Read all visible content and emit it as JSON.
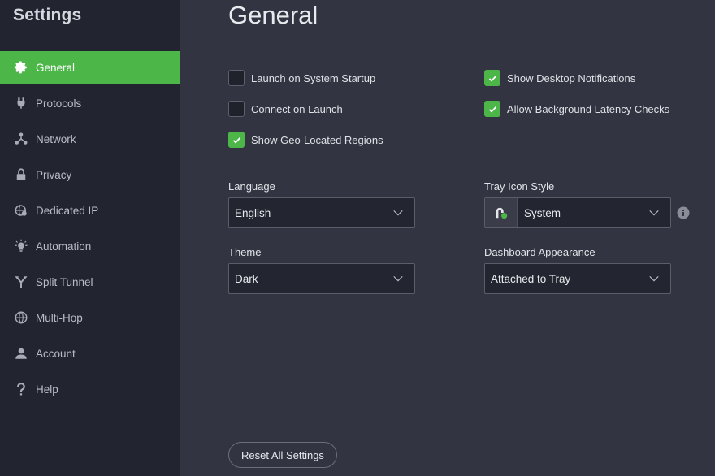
{
  "sidebar": {
    "title": "Settings",
    "items": [
      {
        "label": "General",
        "icon": "gear-icon",
        "active": true
      },
      {
        "label": "Protocols",
        "icon": "plug-icon",
        "active": false
      },
      {
        "label": "Network",
        "icon": "network-icon",
        "active": false
      },
      {
        "label": "Privacy",
        "icon": "lock-icon",
        "active": false
      },
      {
        "label": "Dedicated IP",
        "icon": "globe-pin-icon",
        "active": false
      },
      {
        "label": "Automation",
        "icon": "lightbulb-icon",
        "active": false
      },
      {
        "label": "Split Tunnel",
        "icon": "split-icon",
        "active": false
      },
      {
        "label": "Multi-Hop",
        "icon": "globe-icon",
        "active": false
      },
      {
        "label": "Account",
        "icon": "user-icon",
        "active": false
      },
      {
        "label": "Help",
        "icon": "question-icon",
        "active": false
      }
    ]
  },
  "main": {
    "title": "General",
    "checkboxes": {
      "launch_on_startup": {
        "label": "Launch on System Startup",
        "checked": false
      },
      "connect_on_launch": {
        "label": "Connect on Launch",
        "checked": false
      },
      "show_geo_regions": {
        "label": "Show Geo-Located Regions",
        "checked": true
      },
      "desktop_notifications": {
        "label": "Show Desktop Notifications",
        "checked": true
      },
      "background_latency": {
        "label": "Allow Background Latency Checks",
        "checked": true
      }
    },
    "language": {
      "label": "Language",
      "value": "English"
    },
    "theme": {
      "label": "Theme",
      "value": "Dark"
    },
    "tray_icon_style": {
      "label": "Tray Icon Style",
      "value": "System"
    },
    "dashboard_appearance": {
      "label": "Dashboard Appearance",
      "value": "Attached to Tray"
    },
    "reset_label": "Reset All Settings"
  },
  "colors": {
    "accent": "#4cb649",
    "sidebar_bg": "#222530",
    "main_bg": "#323541"
  }
}
